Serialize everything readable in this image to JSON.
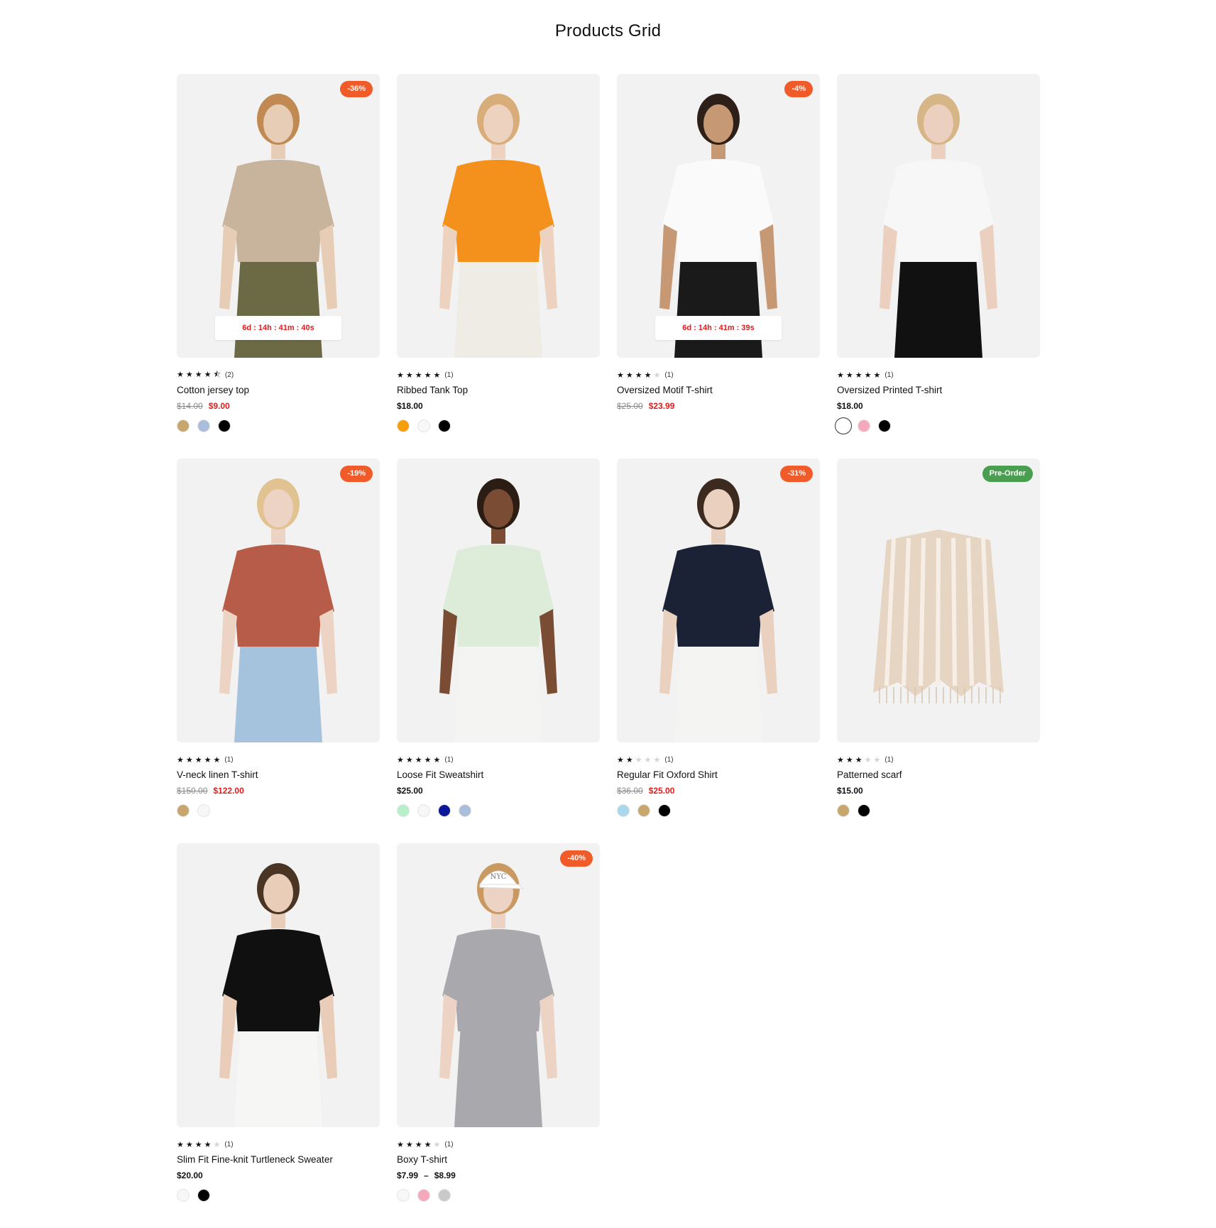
{
  "page": {
    "title": "Products Grid"
  },
  "products": [
    {
      "name": "Cotton jersey top",
      "rating": 4.5,
      "reviews": "(2)",
      "price_old": "$14.00",
      "price": "$9.00",
      "badge": "-36%",
      "badge_type": "sale",
      "countdown": "6d : 14h : 41m : 40s",
      "swatches": [
        "#c7a76e",
        "#a8bedb",
        "#000000"
      ],
      "active_swatch": -1,
      "figure": {
        "top": "#c8b49c",
        "bottom": "#6b6a45",
        "skin": "#e8cdb6",
        "hair": "#c08a52"
      }
    },
    {
      "name": "Ribbed Tank Top",
      "rating": 5,
      "reviews": "(1)",
      "price": "$18.00",
      "swatches": [
        "#f5a00a",
        "#f7f7f7",
        "#000000"
      ],
      "active_swatch": -1,
      "figure": {
        "top": "#f4901c",
        "bottom": "#efece5",
        "skin": "#ecd2bf",
        "hair": "#d8ad7a"
      }
    },
    {
      "name": "Oversized Motif T-shirt",
      "rating": 4,
      "reviews": "(1)",
      "price_old": "$25.00",
      "price": "$23.99",
      "badge": "-4%",
      "badge_type": "sale",
      "countdown": "6d : 14h : 41m : 39s",
      "swatches": [],
      "active_swatch": -1,
      "figure": {
        "top": "#fafafa",
        "bottom": "#1a1a1a",
        "skin": "#c79874",
        "hair": "#2e2018"
      }
    },
    {
      "name": "Oversized Printed T-shirt",
      "rating": 5,
      "reviews": "(1)",
      "price": "$18.00",
      "swatches": [
        "#ffffff",
        "#f6a9bd",
        "#000000"
      ],
      "active_swatch": 0,
      "figure": {
        "top": "#f7f7f7",
        "bottom": "#111111",
        "skin": "#ebd0bf",
        "hair": "#d6b587"
      }
    },
    {
      "name": "V-neck linen T-shirt",
      "rating": 5,
      "reviews": "(1)",
      "price_old": "$150.00",
      "price": "$122.00",
      "badge": "-19%",
      "badge_type": "sale",
      "swatches": [
        "#c7a76e",
        "#f7f7f7"
      ],
      "active_swatch": -1,
      "figure": {
        "top": "#b75c48",
        "bottom": "#a5c3dd",
        "skin": "#ecd3c3",
        "hair": "#e0c391"
      }
    },
    {
      "name": "Loose Fit Sweatshirt",
      "rating": 5,
      "reviews": "(1)",
      "price": "$25.00",
      "swatches": [
        "#b6f0c9",
        "#f7f7f7",
        "#0c1897",
        "#a8bedb"
      ],
      "active_swatch": -1,
      "figure": {
        "top": "#dcecd9",
        "bottom": "#f4f4f2",
        "skin": "#7a4c33",
        "hair": "#2b1d14"
      }
    },
    {
      "name": "Regular Fit Oxford Shirt",
      "rating": 2,
      "reviews": "(1)",
      "price_old": "$36.00",
      "price": "$25.00",
      "badge": "-31%",
      "badge_type": "sale",
      "swatches": [
        "#a9d8ec",
        "#c7a76e",
        "#000000"
      ],
      "active_swatch": -1,
      "figure": {
        "top": "#1b2235",
        "bottom": "#f4f4f2",
        "skin": "#ead0bf",
        "hair": "#3d2a1e"
      }
    },
    {
      "name": "Patterned scarf",
      "rating": 3,
      "reviews": "(1)",
      "price": "$15.00",
      "badge": "Pre-Order",
      "badge_type": "preorder",
      "swatches": [
        "#c7a76e",
        "#000000"
      ],
      "active_swatch": -1,
      "figure": {
        "top": "#e6d5c2",
        "bottom": "#f2f2f2",
        "skin": "#f2f2f2",
        "hair": "#f2f2f2",
        "scarf": true
      }
    },
    {
      "name": "Slim Fit Fine-knit Turtleneck Sweater",
      "rating": 4,
      "reviews": "(1)",
      "price": "$20.00",
      "swatches": [
        "#f7f7f7",
        "#000000"
      ],
      "active_swatch": -1,
      "figure": {
        "top": "#101010",
        "bottom": "#f6f6f4",
        "skin": "#e9cdb9",
        "hair": "#4a3424"
      }
    },
    {
      "name": "Boxy T-shirt",
      "rating": 4,
      "reviews": "(1)",
      "price_range_low": "$7.99",
      "price_range_sep": "–",
      "price_range_high": "$8.99",
      "badge": "-40%",
      "badge_type": "sale",
      "swatches": [
        "#f7f7f7",
        "#f6a9bd",
        "#c9c9c9"
      ],
      "active_swatch": -1,
      "figure": {
        "top": "#a9a9ad",
        "bottom": "#a9a9ad",
        "skin": "#ecd3c3",
        "hair": "#c89a62",
        "cap": "#ffffff",
        "cap_text": "NYC"
      }
    }
  ]
}
